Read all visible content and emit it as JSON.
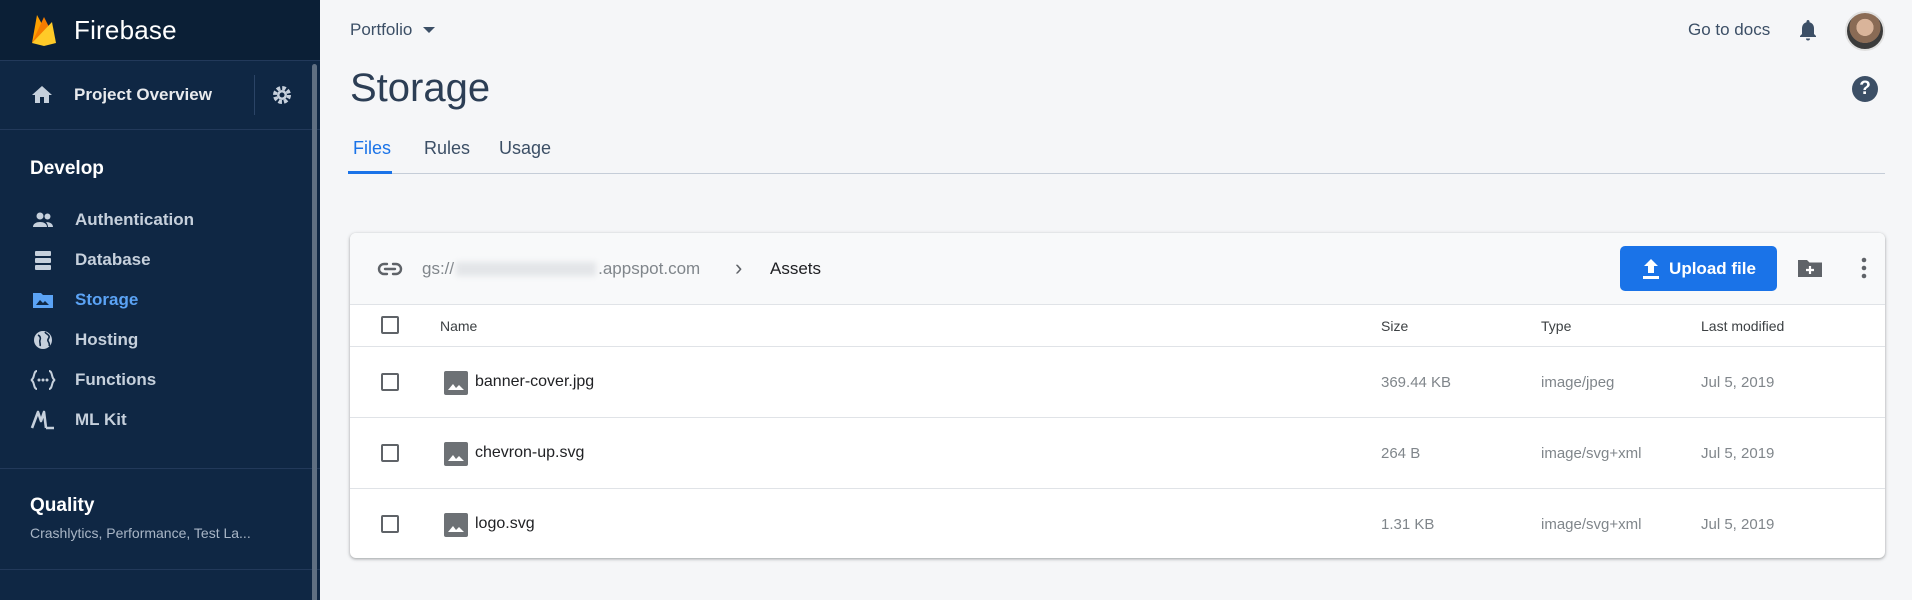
{
  "sidebar": {
    "brand": "Firebase",
    "project_overview": "Project Overview",
    "develop_title": "Develop",
    "items": [
      {
        "label": "Authentication",
        "icon": "people-icon",
        "active": false
      },
      {
        "label": "Database",
        "icon": "database-icon",
        "active": false
      },
      {
        "label": "Storage",
        "icon": "storage-icon",
        "active": true
      },
      {
        "label": "Hosting",
        "icon": "globe-icon",
        "active": false
      },
      {
        "label": "Functions",
        "icon": "functions-icon",
        "active": false
      },
      {
        "label": "ML Kit",
        "icon": "mlkit-icon",
        "active": false
      }
    ],
    "quality_title": "Quality",
    "quality_sub": "Crashlytics, Performance, Test La..."
  },
  "header": {
    "project": "Portfolio",
    "docs_link": "Go to docs"
  },
  "page": {
    "title": "Storage",
    "help": "?",
    "tabs": [
      "Files",
      "Rules",
      "Usage"
    ],
    "active_tab": "Files"
  },
  "bucket": {
    "prefix": "gs://",
    "suffix": ".appspot.com",
    "separator": "›",
    "folder": "Assets",
    "upload_label": "Upload file"
  },
  "table": {
    "columns": [
      "Name",
      "Size",
      "Type",
      "Last modified"
    ],
    "rows": [
      {
        "name": "banner-cover.jpg",
        "size": "369.44 KB",
        "type": "image/jpeg",
        "modified": "Jul 5, 2019"
      },
      {
        "name": "chevron-up.svg",
        "size": "264 B",
        "type": "image/svg+xml",
        "modified": "Jul 5, 2019"
      },
      {
        "name": "logo.svg",
        "size": "1.31 KB",
        "type": "image/svg+xml",
        "modified": "Jul 5, 2019"
      }
    ]
  },
  "colors": {
    "sidebar_bg": "#0f2744",
    "accent": "#1a73e8",
    "active_nav": "#5ba3f5"
  }
}
